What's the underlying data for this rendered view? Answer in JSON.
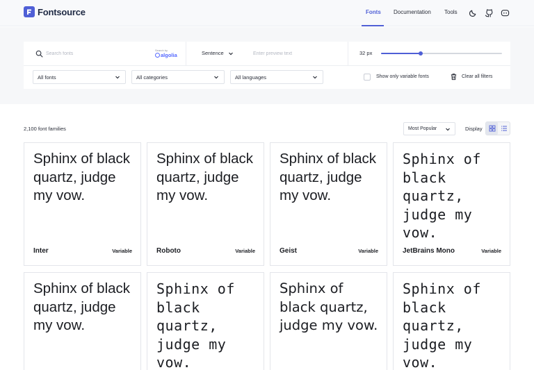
{
  "header": {
    "brand": "Fontsource",
    "nav": {
      "fonts": "Fonts",
      "docs": "Documentation",
      "tools": "Tools"
    },
    "icons": [
      "moon-icon",
      "github-icon",
      "discord-icon"
    ],
    "accent": "#4f5fd6"
  },
  "search": {
    "placeholder": "Search fonts",
    "powered_by": "Search by",
    "algolia": "algolia",
    "preview_mode": "Sentence",
    "preview_placeholder": "Enter preview text",
    "size_label": "32 px",
    "size_fraction": 0.33
  },
  "filters": {
    "fonts": "All fonts",
    "categories": "All categories",
    "languages": "All languages",
    "variable_only": "Show only variable fonts",
    "clear": "Clear all filters"
  },
  "toolbar": {
    "count": "2,100 font families",
    "sort": "Most Popular",
    "display": "Display"
  },
  "cards": [
    {
      "preview": "Sphinx of black quartz, judge my vow.",
      "name": "Inter",
      "badge": "Variable"
    },
    {
      "preview": "Sphinx of black quartz, judge my vow.",
      "name": "Roboto",
      "badge": "Variable"
    },
    {
      "preview": "Sphinx of black quartz, judge my vow.",
      "name": "Geist",
      "badge": "Variable"
    },
    {
      "preview": "Sphinx of black quartz, judge my vow.",
      "name": "JetBrains Mono",
      "badge": "Variable"
    },
    {
      "preview": "Sphinx of black quartz, judge my vow."
    },
    {
      "preview": "Sphinx of black quartz, judge my vow."
    },
    {
      "preview": "Sphinx of black quartz, judge my vow."
    },
    {
      "preview": "Sphinx of black quartz, judge my vow."
    }
  ]
}
